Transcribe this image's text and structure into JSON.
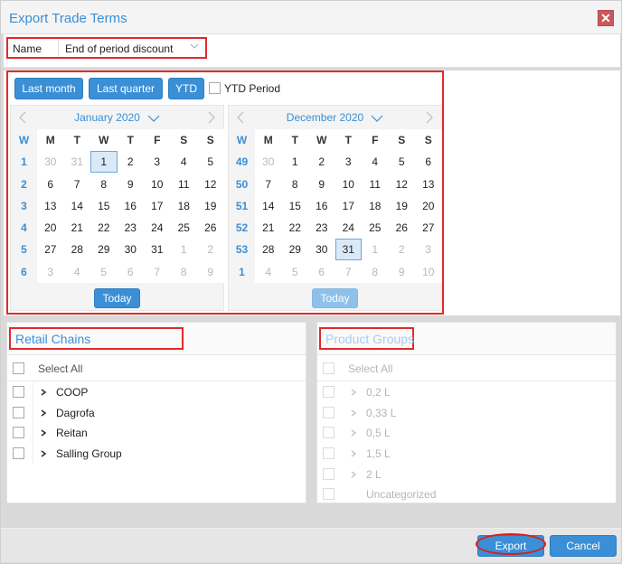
{
  "dialog": {
    "title": "Export Trade Terms",
    "close_icon": "close-icon",
    "close_glyph": "✕"
  },
  "name_field": {
    "label": "Name",
    "value": "End of period discount"
  },
  "period": {
    "buttons": {
      "last_month": "Last month",
      "last_quarter": "Last quarter",
      "ytd": "YTD"
    },
    "ytd_period": {
      "label": "YTD Period",
      "checked": false
    },
    "weekday_headers": [
      "M",
      "T",
      "W",
      "T",
      "F",
      "S",
      "S"
    ],
    "week_header": "W",
    "today_label": "Today",
    "calendars": [
      {
        "title": "January 2020",
        "weeks": [
          {
            "wk": "1",
            "days": [
              {
                "d": "30",
                "o": true
              },
              {
                "d": "31",
                "o": true
              },
              {
                "d": "1",
                "s": true
              },
              {
                "d": "2"
              },
              {
                "d": "3"
              },
              {
                "d": "4"
              },
              {
                "d": "5"
              }
            ]
          },
          {
            "wk": "2",
            "days": [
              {
                "d": "6"
              },
              {
                "d": "7"
              },
              {
                "d": "8"
              },
              {
                "d": "9"
              },
              {
                "d": "10"
              },
              {
                "d": "11"
              },
              {
                "d": "12"
              }
            ]
          },
          {
            "wk": "3",
            "days": [
              {
                "d": "13"
              },
              {
                "d": "14"
              },
              {
                "d": "15"
              },
              {
                "d": "16"
              },
              {
                "d": "17"
              },
              {
                "d": "18"
              },
              {
                "d": "19"
              }
            ]
          },
          {
            "wk": "4",
            "days": [
              {
                "d": "20"
              },
              {
                "d": "21"
              },
              {
                "d": "22"
              },
              {
                "d": "23"
              },
              {
                "d": "24"
              },
              {
                "d": "25"
              },
              {
                "d": "26"
              }
            ]
          },
          {
            "wk": "5",
            "days": [
              {
                "d": "27"
              },
              {
                "d": "28"
              },
              {
                "d": "29"
              },
              {
                "d": "30"
              },
              {
                "d": "31"
              },
              {
                "d": "1",
                "o": true
              },
              {
                "d": "2",
                "o": true
              }
            ]
          },
          {
            "wk": "6",
            "days": [
              {
                "d": "3",
                "o": true
              },
              {
                "d": "4",
                "o": true
              },
              {
                "d": "5",
                "o": true
              },
              {
                "d": "6",
                "o": true
              },
              {
                "d": "7",
                "o": true
              },
              {
                "d": "8",
                "o": true
              },
              {
                "d": "9",
                "o": true
              }
            ]
          }
        ],
        "today_enabled": true
      },
      {
        "title": "December 2020",
        "weeks": [
          {
            "wk": "49",
            "days": [
              {
                "d": "30",
                "o": true
              },
              {
                "d": "1"
              },
              {
                "d": "2"
              },
              {
                "d": "3"
              },
              {
                "d": "4"
              },
              {
                "d": "5"
              },
              {
                "d": "6"
              }
            ]
          },
          {
            "wk": "50",
            "days": [
              {
                "d": "7"
              },
              {
                "d": "8"
              },
              {
                "d": "9"
              },
              {
                "d": "10"
              },
              {
                "d": "11"
              },
              {
                "d": "12"
              },
              {
                "d": "13"
              }
            ]
          },
          {
            "wk": "51",
            "days": [
              {
                "d": "14"
              },
              {
                "d": "15"
              },
              {
                "d": "16"
              },
              {
                "d": "17"
              },
              {
                "d": "18"
              },
              {
                "d": "19"
              },
              {
                "d": "20"
              }
            ]
          },
          {
            "wk": "52",
            "days": [
              {
                "d": "21"
              },
              {
                "d": "22"
              },
              {
                "d": "23"
              },
              {
                "d": "24"
              },
              {
                "d": "25"
              },
              {
                "d": "26"
              },
              {
                "d": "27"
              }
            ]
          },
          {
            "wk": "53",
            "days": [
              {
                "d": "28"
              },
              {
                "d": "29"
              },
              {
                "d": "30"
              },
              {
                "d": "31",
                "s": true
              },
              {
                "d": "1",
                "o": true
              },
              {
                "d": "2",
                "o": true
              },
              {
                "d": "3",
                "o": true
              }
            ]
          },
          {
            "wk": "1",
            "days": [
              {
                "d": "4",
                "o": true
              },
              {
                "d": "5",
                "o": true
              },
              {
                "d": "6",
                "o": true
              },
              {
                "d": "7",
                "o": true
              },
              {
                "d": "8",
                "o": true
              },
              {
                "d": "9",
                "o": true
              },
              {
                "d": "10",
                "o": true
              }
            ]
          }
        ],
        "today_enabled": false
      }
    ]
  },
  "retail_chains": {
    "title": "Retail Chains",
    "select_all": "Select All",
    "items": [
      {
        "label": "COOP",
        "expandable": true
      },
      {
        "label": "Dagrofa",
        "expandable": true
      },
      {
        "label": "Reitan",
        "expandable": true
      },
      {
        "label": "Salling Group",
        "expandable": true
      }
    ]
  },
  "product_groups": {
    "title": "Product Groups",
    "disabled": true,
    "select_all": "Select All",
    "items": [
      {
        "label": "0,2 L",
        "expandable": true
      },
      {
        "label": "0,33 L",
        "expandable": true
      },
      {
        "label": "0,5 L",
        "expandable": true
      },
      {
        "label": "1,5 L",
        "expandable": true
      },
      {
        "label": "2 L",
        "expandable": true
      },
      {
        "label": "Uncategorized",
        "expandable": false
      }
    ]
  },
  "footer": {
    "export_label": "Export",
    "cancel_label": "Cancel"
  },
  "colors": {
    "accent": "#3a8fd6",
    "highlight_red": "#e02a2a",
    "close_bg": "#c9585a"
  }
}
